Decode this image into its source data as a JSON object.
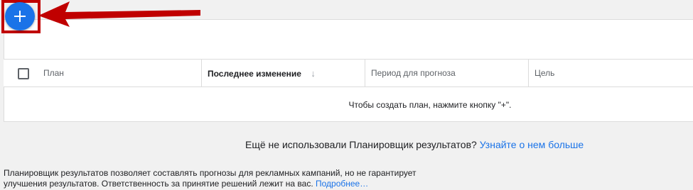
{
  "toolbar": {
    "add_button_icon": "plus-icon",
    "accent_color": "#1a73e8",
    "annotation_color": "#c00000"
  },
  "table": {
    "columns": [
      "План",
      "Последнее изменение",
      "Период для прогноза",
      "Цель"
    ],
    "sort_icon": "arrow-down-icon",
    "empty_message": "Чтобы создать план, нажмите кнопку \"+\"."
  },
  "promo": {
    "text": "Ещё не использовали Планировщик результатов?",
    "link": "Узнайте о нем больше"
  },
  "disclaimer": {
    "line1": "Планировщик результатов позволяет составлять прогнозы для рекламных кампаний, но не гарантирует",
    "line2": "улучшения результатов. Ответственность за принятие решений лежит на вас.",
    "link": "Подробнее…"
  }
}
